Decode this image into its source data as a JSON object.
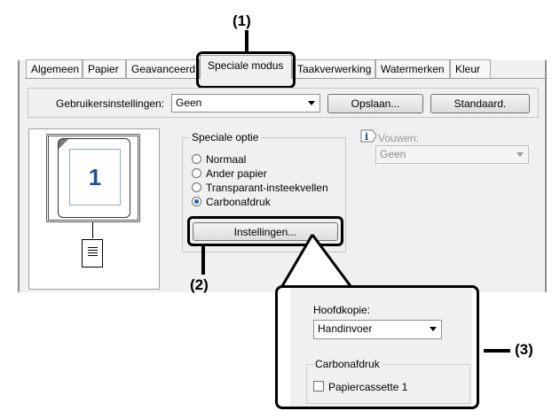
{
  "callouts": {
    "c1": "(1)",
    "c2": "(2)",
    "c3": "(3)"
  },
  "tabs": [
    "Algemeen",
    "Papier",
    "Geavanceerd",
    "Speciale modus",
    "Taakverwerking",
    "Watermerken",
    "Kleur"
  ],
  "active_tab": "Speciale modus",
  "user_settings": {
    "label": "Gebruikersinstellingen:",
    "value": "Geen",
    "save_button": "Opslaan...",
    "default_button": "Standaard."
  },
  "preview": {
    "page_number": "1"
  },
  "special_options": {
    "legend": "Speciale optie",
    "options": [
      "Normaal",
      "Ander papier",
      "Transparant-insteekvellen",
      "Carbonafdruk"
    ],
    "selected": "Carbonafdruk",
    "settings_button": "Instellingen..."
  },
  "folding": {
    "label": "Vouwen:",
    "value": "Geen"
  },
  "zoom_panel": {
    "master_copy_label": "Hoofdkopie:",
    "master_copy_value": "Handinvoer",
    "carbon_legend": "Carbonafdruk",
    "tray_checkbox_label": "Papiercassette 1"
  }
}
